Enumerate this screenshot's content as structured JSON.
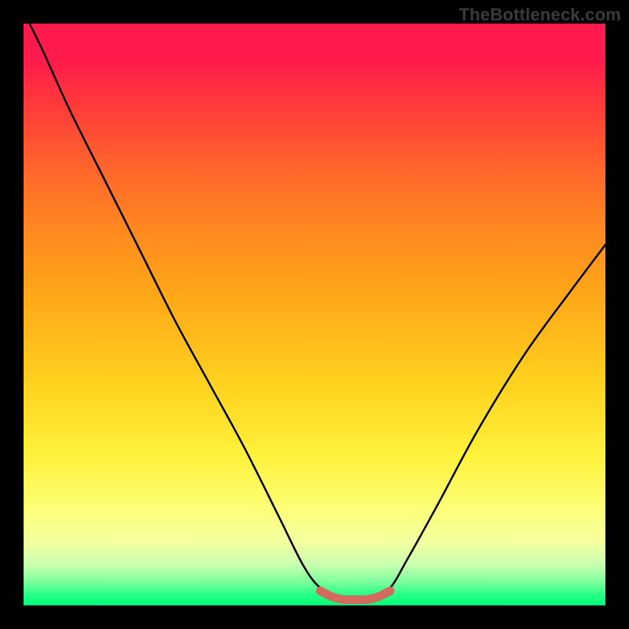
{
  "watermark": "TheBottleneck.com",
  "colors": {
    "frame": "#000000",
    "gradient_top": "#ff1a4d",
    "gradient_bottom": "#00ff78",
    "curve": "#000000",
    "highlight": "#d46a5e"
  },
  "chart_data": {
    "type": "line",
    "title": "",
    "xlabel": "",
    "ylabel": "",
    "xlim": [
      0,
      100
    ],
    "ylim": [
      0,
      100
    ],
    "series": [
      {
        "name": "bottleneck-curve",
        "x": [
          0,
          3,
          8,
          14,
          20,
          26,
          32,
          38,
          44,
          48,
          51,
          55,
          60,
          63,
          66,
          71,
          78,
          86,
          94,
          100
        ],
        "y": [
          102,
          96,
          85,
          73,
          61,
          49,
          38,
          27,
          15,
          7,
          3,
          1,
          1,
          3,
          8,
          17,
          30,
          43,
          54,
          62
        ]
      },
      {
        "name": "optimal-range-highlight",
        "x": [
          51,
          53,
          55,
          57,
          59,
          61,
          63
        ],
        "y": [
          2.5,
          1.5,
          1.0,
          1.0,
          1.0,
          1.5,
          2.5
        ]
      }
    ]
  }
}
